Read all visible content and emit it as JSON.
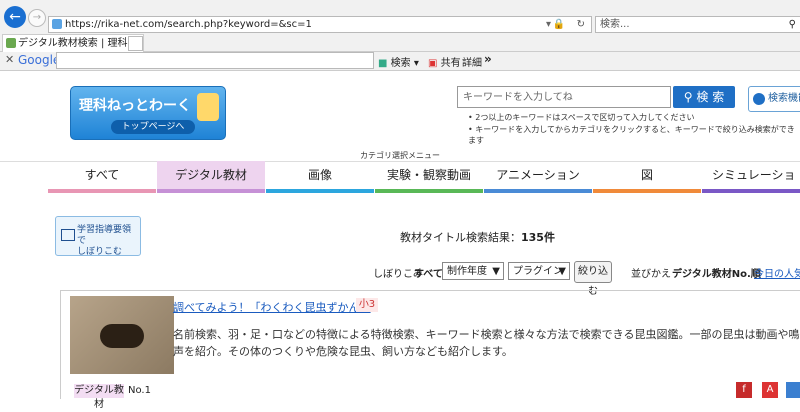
{
  "browser": {
    "url": "https://rika-net.com/search.php?keyword=&sc=1",
    "search_placeholder": "検索...",
    "tab_title": "デジタル教材検索 | 理科ねっ...",
    "google_label": "Google",
    "toolbar": {
      "search": "検索",
      "share": "共有",
      "detail": "詳細",
      "more": "»"
    }
  },
  "site": {
    "logo_title": "理科ねっとわーく",
    "logo_sub": "トップページへ",
    "kw_placeholder": "キーワードを入力してね",
    "kw_button": "検 索",
    "tip1": "2つ以上のキーワードはスペースで区切って入力してください",
    "tip2": "キーワードを入力してからカテゴリをクリックすると、キーワードで絞り込み検索ができます",
    "kiki_button": "検索機能",
    "cat_label": "カテゴリ選択メニュー",
    "categories": [
      "すべて",
      "デジタル教材",
      "画像",
      "実験・観察動画",
      "アニメーション",
      "図",
      "シミュレーショ"
    ],
    "cat_colors": [
      "#e896b4",
      "#c691d6",
      "#2ca6de",
      "#59b857",
      "#4a8bd6",
      "#f08a3a",
      "#7a58c6"
    ],
    "subject_button": "学習指導要領で\nしぼりこむ",
    "result_prefix": "教材タイトル検索結果：",
    "result_count": "135件",
    "narrow": "しぼりこみ",
    "all": "すべて",
    "select_year": "制作年度",
    "select_plugin": "プラグイン",
    "narrow_btn": "絞り込む",
    "sort_label": "並びかえ",
    "sort_current": "デジタル教材No.順",
    "sort_popular": "今日の人気順"
  },
  "item": {
    "title": "調べてみよう！「わくわく昆虫ずかん」",
    "grade": "小3",
    "desc": "名前検索、羽・足・口などの特徴による特徴検索、キーワード検索と様々な方法で検索できる昆虫図鑑。一部の昆虫は動画や鳴き声を紹介。その体のつくりや危険な昆虫、飼い方なども紹介します。",
    "tag": "デジタル教材",
    "no": "No.1"
  }
}
